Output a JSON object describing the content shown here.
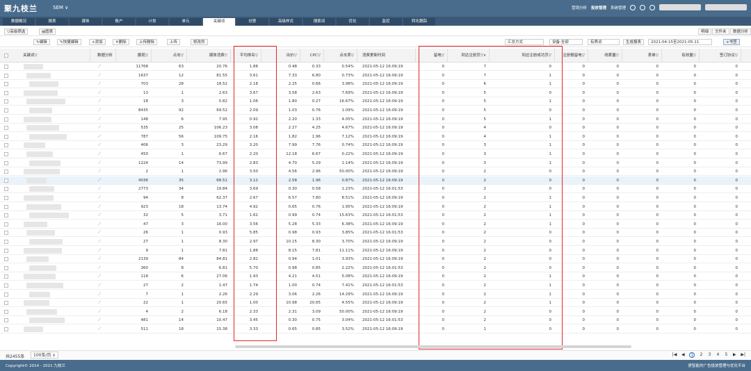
{
  "app": {
    "logo": "聚九枝兰",
    "product": "SEM ∨",
    "top_links": [
      "营销分析",
      "投放管理",
      "系统管理"
    ]
  },
  "tabs": [
    "数据概况",
    "报表",
    "媒体",
    "账户",
    "计划",
    "单元",
    "关键词",
    "创意",
    "高级样式",
    "搜索词",
    "优化",
    "监控",
    "转化跟踪"
  ],
  "active_tab": "关键词",
  "toolbar1": {
    "filter": "▽高级筛选",
    "chart": "▤图表"
  },
  "toolbar2": {
    "edit": "✎编辑",
    "quick_edit": "✎快捷编辑",
    "add": "+添加",
    "delete": "✕删除",
    "upload_delete": "上传删除",
    "upload": "上传",
    "modify_col": "修改列",
    "dim_select": "汇总方式",
    "device": "设备:全部",
    "valid": "有质词",
    "gen_report": "生成报表",
    "date_range": "2021-04-15至2021-05-11",
    "bookmark": "+书签"
  },
  "view_btns": [
    "明细",
    "文件夹",
    "数据分析"
  ],
  "columns": [
    "关键词▽",
    "数据分析",
    "展现▽",
    "点击▽",
    "媒体消费▽",
    "平均排名▽",
    "出价▽",
    "CPC▽",
    "点击率▽",
    "消费更新时间",
    "留电▽",
    "到达注册页▽∨",
    "到达注册成功页▽",
    "注册报留电▽",
    "线索量▽",
    "表单▽",
    "有效量▽",
    "签订协议▽"
  ],
  "rows": [
    [
      "11768",
      "63",
      "20.76",
      "1.88",
      "0.48",
      "0.33",
      "0.54%",
      "2021-05-12 16:09:19",
      "0",
      "7",
      "0",
      "0",
      "0",
      "0",
      "0",
      "0"
    ],
    [
      "1637",
      "12",
      "81.55",
      "3.61",
      "7.33",
      "6.80",
      "0.73%",
      "2021-05-12 16:09:19",
      "0",
      "7",
      "1",
      "0",
      "0",
      "0",
      "0",
      "0"
    ],
    [
      "703",
      "28",
      "18.52",
      "2.18",
      "2.25",
      "0.66",
      "3.98%",
      "2021-05-12 16:09:19",
      "0",
      "6",
      "1",
      "0",
      "0",
      "0",
      "0",
      "0"
    ],
    [
      "13",
      "1",
      "2.63",
      "3.67",
      "3.58",
      "2.63",
      "7.69%",
      "2021-05-12 16:09:19",
      "0",
      "5",
      "0",
      "0",
      "0",
      "0",
      "0",
      "0"
    ],
    [
      "18",
      "3",
      "0.82",
      "1.06",
      "1.80",
      "0.27",
      "16.67%",
      "2021-05-12 16:09:19",
      "0",
      "5",
      "1",
      "0",
      "0",
      "0",
      "0",
      "0"
    ],
    [
      "8435",
      "92",
      "69.52",
      "2.09",
      "1.03",
      "0.76",
      "1.09%",
      "2021-05-12 16:09:19",
      "0",
      "5",
      "0",
      "0",
      "0",
      "0",
      "0",
      "0"
    ],
    [
      "148",
      "6",
      "7.95",
      "0.92",
      "2.20",
      "1.33",
      "4.05%",
      "2021-05-12 16:09:19",
      "0",
      "5",
      "1",
      "0",
      "0",
      "0",
      "0",
      "0"
    ],
    [
      "535",
      "25",
      "106.23",
      "3.08",
      "2.27",
      "4.25",
      "4.67%",
      "2021-05-12 16:09:19",
      "0",
      "4",
      "0",
      "0",
      "0",
      "0",
      "0",
      "0"
    ],
    [
      "787",
      "56",
      "109.75",
      "2.16",
      "1.82",
      "1.96",
      "7.12%",
      "2021-05-12 16:09:19",
      "0",
      "4",
      "1",
      "0",
      "0",
      "0",
      "0",
      "0"
    ],
    [
      "406",
      "3",
      "23.29",
      "3.20",
      "7.99",
      "7.76",
      "0.74%",
      "2021-05-12 16:09:19",
      "0",
      "3",
      "1",
      "0",
      "0",
      "0",
      "0",
      "0"
    ],
    [
      "450",
      "1",
      "6.67",
      "2.20",
      "12.18",
      "6.67",
      "0.22%",
      "2021-05-12 16:09:19",
      "0",
      "3",
      "1",
      "0",
      "0",
      "0",
      "0",
      "0"
    ],
    [
      "1224",
      "14",
      "73.99",
      "2.83",
      "4.70",
      "5.29",
      "1.14%",
      "2021-05-12 16:09:19",
      "0",
      "3",
      "1",
      "0",
      "0",
      "0",
      "0",
      "0"
    ],
    [
      "2",
      "1",
      "2.96",
      "3.50",
      "4.56",
      "2.96",
      "50.00%",
      "2021-05-12 16:09:19",
      "0",
      "2",
      "0",
      "0",
      "0",
      "0",
      "0",
      "0"
    ],
    [
      "4036",
      "35",
      "68.51",
      "3.12",
      "2.58",
      "1.96",
      "0.87%",
      "2021-05-12 16:09:19",
      "0",
      "2",
      "0",
      "0",
      "0",
      "0",
      "0",
      "0"
    ],
    [
      "2773",
      "34",
      "19.84",
      "3.69",
      "0.30",
      "0.58",
      "1.23%",
      "2021-05-12 16:01:53",
      "0",
      "2",
      "0",
      "0",
      "0",
      "0",
      "0",
      "0"
    ],
    [
      "94",
      "8",
      "62.37",
      "2.67",
      "6.57",
      "7.80",
      "8.51%",
      "2021-05-12 16:09:19",
      "0",
      "2",
      "1",
      "0",
      "0",
      "0",
      "0",
      "0"
    ],
    [
      "923",
      "18",
      "13.74",
      "4.92",
      "0.65",
      "0.76",
      "1.95%",
      "2021-05-12 16:09:19",
      "0",
      "2",
      "1",
      "0",
      "0",
      "0",
      "0",
      "0"
    ],
    [
      "32",
      "5",
      "3.71",
      "1.62",
      "0.99",
      "0.74",
      "15.63%",
      "2021-05-12 16:01:53",
      "0",
      "2",
      "1",
      "0",
      "0",
      "0",
      "0",
      "0"
    ],
    [
      "47",
      "3",
      "16.00",
      "3.56",
      "5.28",
      "5.33",
      "6.38%",
      "2021-05-12 16:09:19",
      "0",
      "2",
      "1",
      "0",
      "0",
      "0",
      "0",
      "0"
    ],
    [
      "26",
      "1",
      "0.93",
      "5.85",
      "0.98",
      "0.93",
      "3.85%",
      "2021-05-12 16:01:53",
      "0",
      "2",
      "0",
      "0",
      "0",
      "0",
      "0",
      "0"
    ],
    [
      "27",
      "1",
      "8.30",
      "2.97",
      "10.15",
      "8.30",
      "3.70%",
      "2021-05-12 16:09:19",
      "0",
      "2",
      "0",
      "0",
      "0",
      "0",
      "0",
      "0"
    ],
    [
      "9",
      "1",
      "7.81",
      "1.88",
      "8.15",
      "7.81",
      "11.11%",
      "2021-05-12 16:09:19",
      "0",
      "2",
      "0",
      "0",
      "0",
      "0",
      "0",
      "0"
    ],
    [
      "2139",
      "84",
      "84.81",
      "2.82",
      "0.94",
      "1.01",
      "3.93%",
      "2021-05-12 16:09:19",
      "0",
      "2",
      "0",
      "0",
      "0",
      "0",
      "0",
      "0"
    ],
    [
      "360",
      "8",
      "6.81",
      "5.70",
      "0.98",
      "0.85",
      "2.22%",
      "2021-05-12 16:01:53",
      "0",
      "2",
      "0",
      "0",
      "0",
      "0",
      "0",
      "0"
    ],
    [
      "118",
      "6",
      "27.06",
      "1.93",
      "4.21",
      "4.51",
      "5.08%",
      "2021-05-12 16:09:19",
      "0",
      "2",
      "1",
      "0",
      "0",
      "0",
      "0",
      "0"
    ],
    [
      "27",
      "2",
      "1.47",
      "1.74",
      "1.00",
      "0.74",
      "7.41%",
      "2021-05-12 16:01:53",
      "0",
      "2",
      "1",
      "0",
      "0",
      "0",
      "0",
      "0"
    ],
    [
      "7",
      "1",
      "2.26",
      "2.29",
      "3.06",
      "2.26",
      "14.29%",
      "2021-05-12 16:09:19",
      "0",
      "2",
      "1",
      "0",
      "0",
      "0",
      "0",
      "0"
    ],
    [
      "22",
      "1",
      "20.65",
      "1.00",
      "10.98",
      "20.65",
      "4.55%",
      "2021-05-12 16:09:19",
      "0",
      "2",
      "1",
      "0",
      "0",
      "0",
      "0",
      "0"
    ],
    [
      "4",
      "2",
      "6.18",
      "2.33",
      "2.31",
      "3.09",
      "50.00%",
      "2021-05-12 16:09:19",
      "0",
      "2",
      "0",
      "0",
      "0",
      "0",
      "0",
      "0"
    ],
    [
      "481",
      "14",
      "10.47",
      "3.45",
      "0.30",
      "0.75",
      "3.04%",
      "2021-05-12 16:01:53",
      "0",
      "2",
      "0",
      "0",
      "0",
      "0",
      "0",
      "0"
    ],
    [
      "511",
      "18",
      "15.38",
      "3.33",
      "0.65",
      "0.85",
      "3.52%",
      "2021-05-12 16:09:19",
      "0",
      "1",
      "0",
      "0",
      "0",
      "0",
      "0",
      "0"
    ]
  ],
  "footer": {
    "total": "共2455条",
    "page_size": "100条/页 ∨",
    "pages": [
      "|◀",
      "◀",
      "1",
      "2",
      "3",
      "4",
      "5",
      "▶",
      "▶|"
    ],
    "current": "1"
  },
  "copyright": "Copyright© 2014 - 2021 九枝兰",
  "slogan": "更智能的广告投放管理与优化平台"
}
